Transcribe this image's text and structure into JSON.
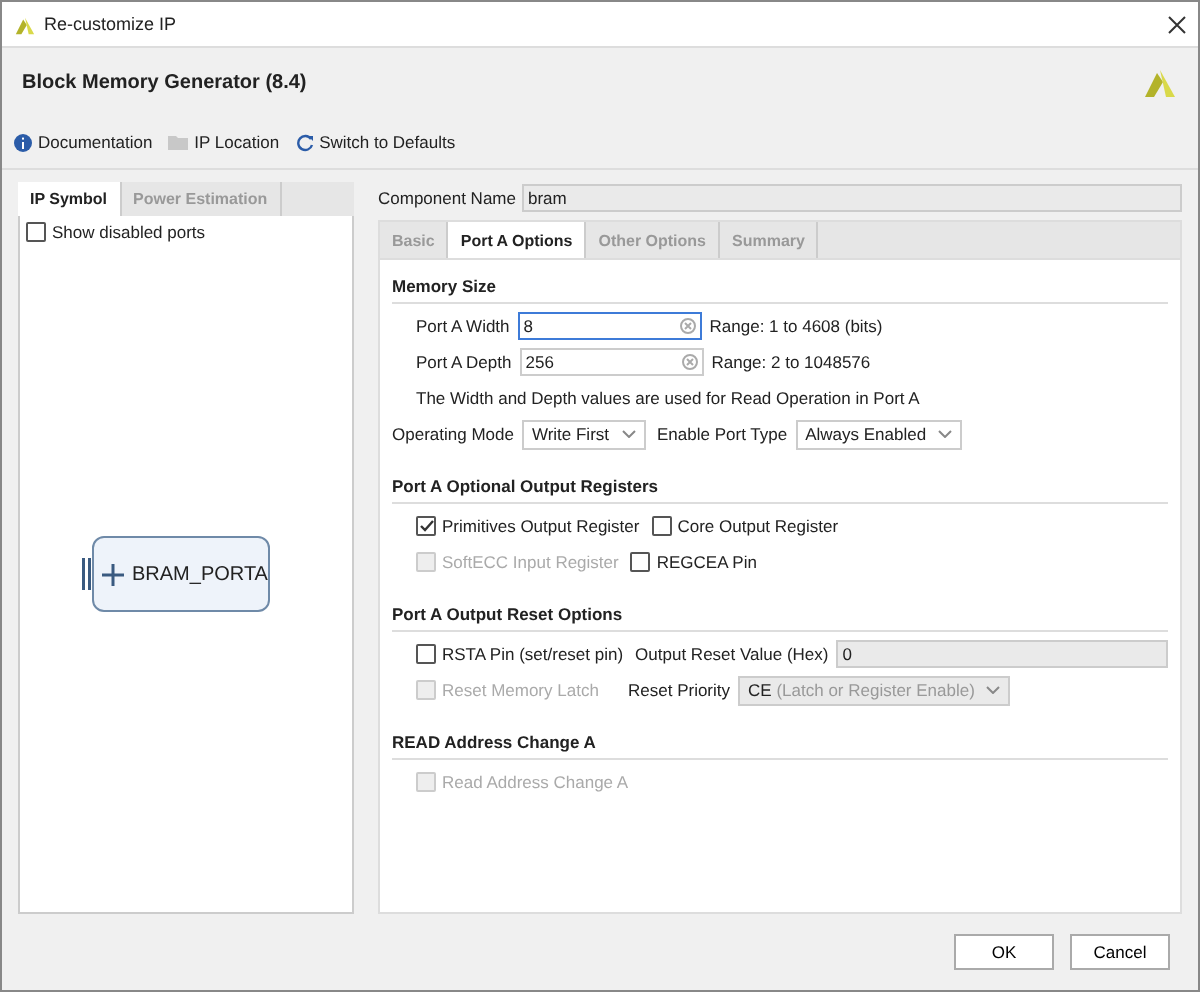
{
  "window": {
    "title": "Re-customize IP"
  },
  "header": {
    "title": "Block Memory Generator (8.4)"
  },
  "toolbar": [
    {
      "kind": "info",
      "label": "Documentation"
    },
    {
      "kind": "folder",
      "label": "IP Location"
    },
    {
      "kind": "refresh",
      "label": "Switch to Defaults"
    }
  ],
  "left_panel": {
    "tabs": [
      {
        "label": "IP Symbol",
        "selected": true
      },
      {
        "label": "Power Estimation",
        "selected": false
      }
    ],
    "show_disabled_ports": {
      "label": "Show disabled ports",
      "checked": false
    },
    "symbol": {
      "label": "BRAM_PORTA"
    }
  },
  "component_name": {
    "label": "Component Name",
    "value": "bram"
  },
  "tabs": [
    {
      "label": "Basic",
      "selected": false
    },
    {
      "label": "Port A Options",
      "selected": true
    },
    {
      "label": "Other Options",
      "selected": false
    },
    {
      "label": "Summary",
      "selected": false
    }
  ],
  "sections": [
    {
      "title": "Memory Size",
      "rows": [
        {
          "indent": true,
          "items": [
            {
              "kind": "field",
              "label": "Port A Width",
              "value": "8",
              "focused": true,
              "clearable": true,
              "hint": "Range: 1 to 4608 (bits)"
            }
          ]
        },
        {
          "indent": true,
          "items": [
            {
              "kind": "field",
              "label": "Port A Depth",
              "value": "256",
              "focused": false,
              "clearable": true,
              "hint": "Range: 2 to 1048576"
            }
          ]
        },
        {
          "indent": true,
          "items": [
            {
              "kind": "note",
              "text": "The Width and Depth values are used for Read Operation in Port A"
            }
          ]
        },
        {
          "indent": false,
          "items": [
            {
              "kind": "select",
              "label": "Operating Mode",
              "value": "Write First",
              "disabled": false
            },
            {
              "kind": "select",
              "label": "Enable Port Type",
              "value": "Always Enabled",
              "disabled": false
            }
          ]
        }
      ]
    },
    {
      "title": "Port A Optional Output Registers",
      "rows": [
        {
          "indent": true,
          "items": [
            {
              "kind": "checkbox",
              "label": "Primitives Output Register",
              "checked": true,
              "disabled": false
            },
            {
              "kind": "checkbox",
              "label": "Core Output Register",
              "checked": false,
              "disabled": false
            }
          ]
        },
        {
          "indent": true,
          "items": [
            {
              "kind": "checkbox",
              "label": "SoftECC Input Register",
              "checked": false,
              "disabled": true
            },
            {
              "kind": "checkbox",
              "label": "REGCEA Pin",
              "checked": false,
              "disabled": false
            }
          ]
        }
      ]
    },
    {
      "title": "Port A Output Reset Options",
      "rows": [
        {
          "indent": true,
          "items": [
            {
              "kind": "checkbox",
              "label": "RSTA Pin (set/reset pin)",
              "checked": false,
              "disabled": false
            },
            {
              "kind": "field",
              "label": "Output Reset Value (Hex)",
              "value": "0",
              "focused": false,
              "clearable": false,
              "disabled": true
            }
          ]
        },
        {
          "indent": true,
          "items": [
            {
              "kind": "checkbox",
              "label": "Reset Memory Latch",
              "checked": false,
              "disabled": true
            },
            {
              "kind": "select",
              "label": "Reset Priority",
              "value": "CE",
              "value_note": "(Latch or Register Enable)",
              "disabled": true
            }
          ]
        }
      ]
    },
    {
      "title": "READ Address Change A",
      "rows": [
        {
          "indent": true,
          "items": [
            {
              "kind": "checkbox",
              "label": "Read Address Change A",
              "checked": false,
              "disabled": true
            }
          ]
        }
      ]
    }
  ],
  "buttons": [
    {
      "label": "OK"
    },
    {
      "label": "Cancel"
    }
  ]
}
